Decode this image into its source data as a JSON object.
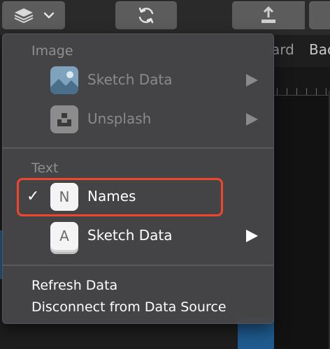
{
  "menu": {
    "image_section": {
      "label": "Image",
      "items": [
        {
          "label": "Sketch Data",
          "icon": "landscape-photo-icon",
          "enabled": false
        },
        {
          "label": "Unsplash",
          "icon": "unsplash-logo-icon",
          "enabled": false
        }
      ]
    },
    "text_section": {
      "label": "Text",
      "items": [
        {
          "label": "Names",
          "icon_letter": "N",
          "checked": true,
          "enabled": true
        },
        {
          "label": "Sketch Data",
          "icon_letter": "A",
          "checked": false,
          "enabled": true
        }
      ]
    },
    "checkmark": "✓",
    "actions": [
      {
        "label": "Refresh Data"
      },
      {
        "label": "Disconnect from Data Source"
      }
    ]
  },
  "background": {
    "label_a": "ard",
    "label_b": "Bac"
  },
  "colors": {
    "highlight": "#f0462e",
    "menu_bg": "#464648",
    "toolbar_button": "#5c5c5c"
  }
}
